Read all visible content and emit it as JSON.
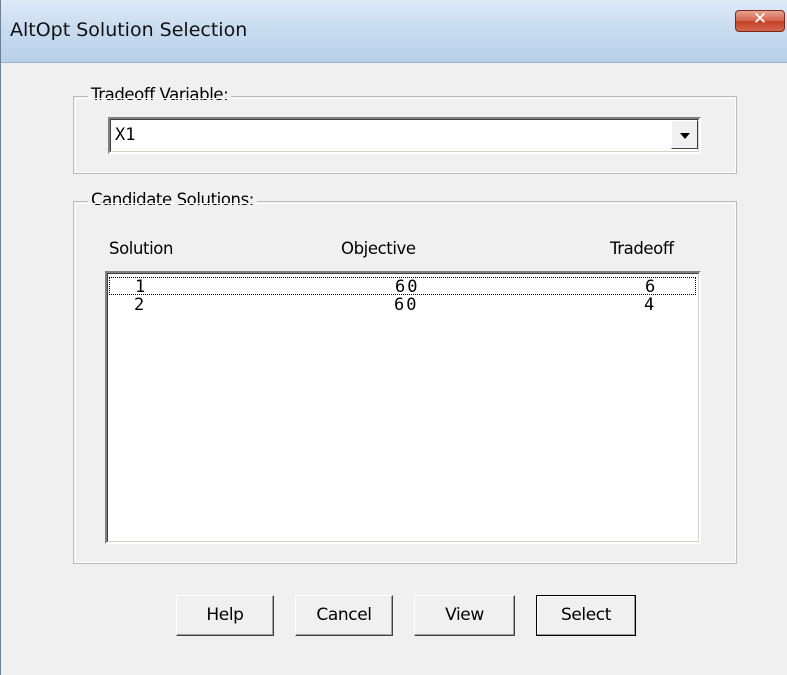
{
  "window": {
    "title": "AltOpt Solution Selection",
    "close_label": "✕"
  },
  "tradeoff": {
    "legend": "Tradeoff Variable:",
    "selected": "X1"
  },
  "candidates": {
    "legend": "Candidate Solutions:",
    "columns": [
      "Solution",
      "Objective",
      "Tradeoff"
    ],
    "rows": [
      {
        "solution": "1",
        "objective": "60",
        "tradeoff": "6"
      },
      {
        "solution": "2",
        "objective": "60",
        "tradeoff": "4"
      }
    ]
  },
  "buttons": {
    "help": "Help",
    "cancel": "Cancel",
    "view": "View",
    "select": "Select"
  },
  "icons": {
    "close": "close-icon",
    "dropdown": "chevron-down-icon"
  }
}
